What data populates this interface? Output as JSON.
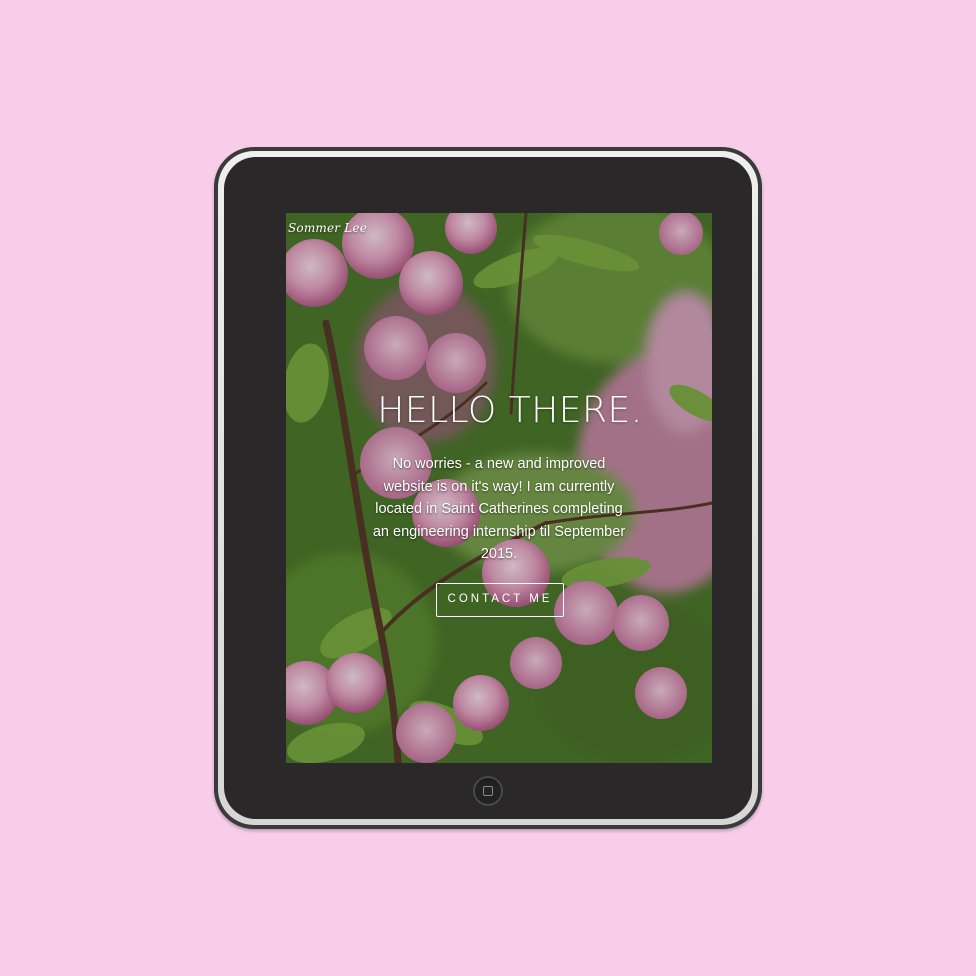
{
  "background_color": "#f8cdea",
  "device": {
    "type": "tablet",
    "body_color": "#2b2829",
    "bezel_color": "#e3e3e3",
    "home_button_icon": "home-square-icon"
  },
  "site": {
    "brand": "Sommer Lee",
    "hero": {
      "title": "HELLO THERE.",
      "text": "No worries - a new and improved website is on it's way! I am currently located in Saint Catherines completing an engineering internship til September 2015.",
      "cta_label": "CONTACT ME"
    },
    "background_image": "pink-blossom-branches-photo"
  }
}
